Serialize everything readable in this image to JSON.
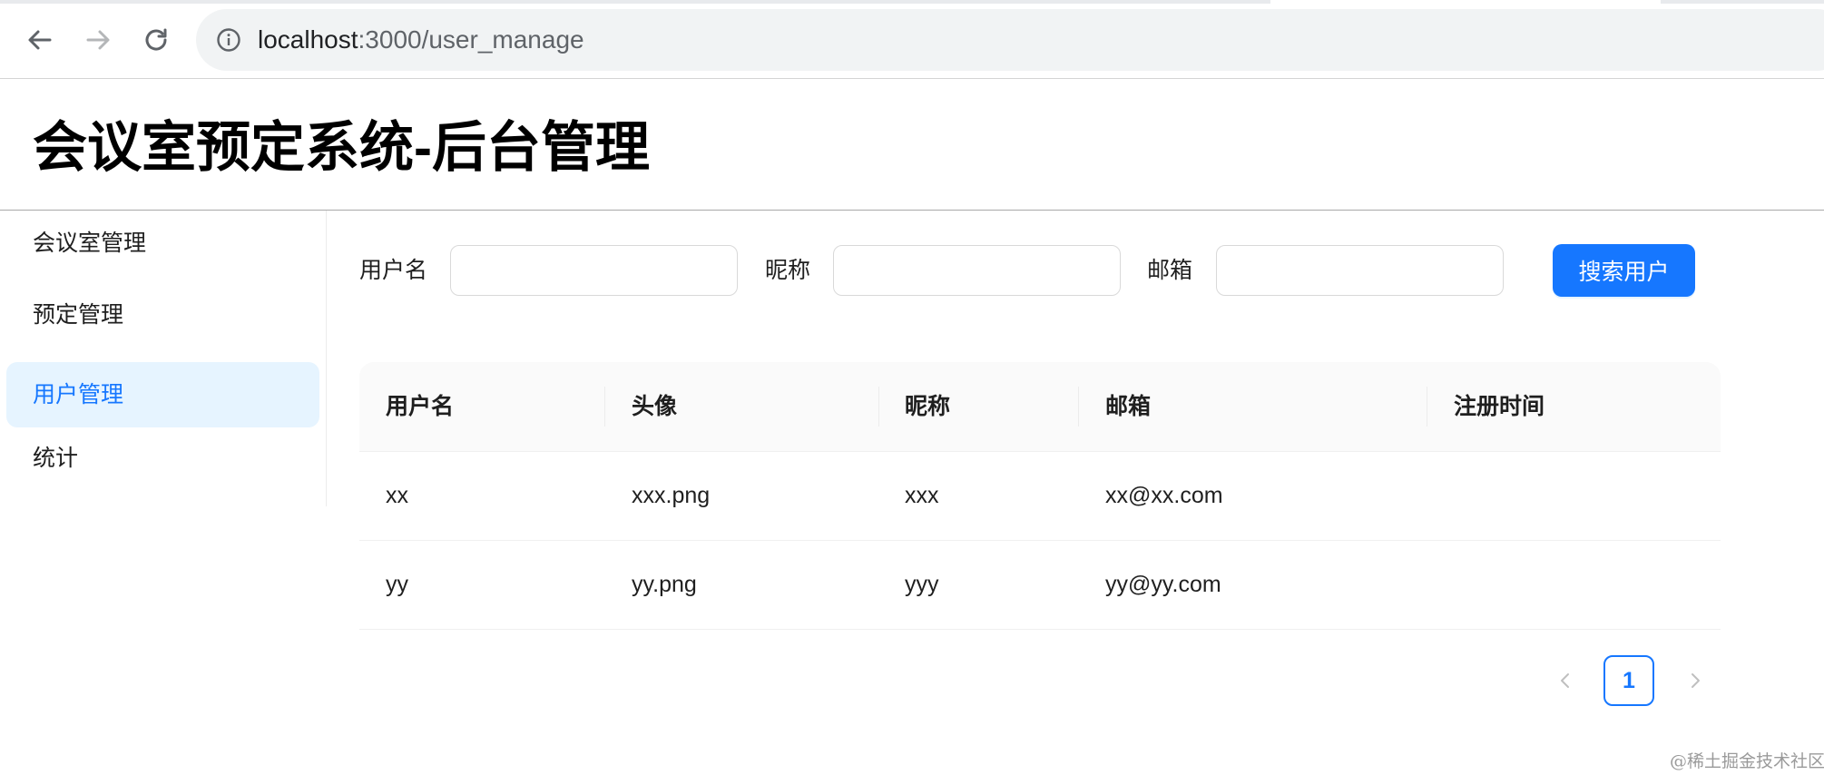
{
  "browser": {
    "url_host": "localhost",
    "url_rest": ":3000/user_manage",
    "back_icon": "arrow-left-icon",
    "forward_icon": "arrow-right-icon",
    "reload_icon": "reload-icon",
    "info_icon": "info-icon"
  },
  "header": {
    "title": "会议室预定系统-后台管理"
  },
  "sidebar": {
    "items": [
      {
        "label": "会议室管理",
        "active": false
      },
      {
        "label": "预定管理",
        "active": false
      },
      {
        "label": "用户管理",
        "active": true
      },
      {
        "label": "统计",
        "active": false
      }
    ]
  },
  "search_form": {
    "username_label": "用户名",
    "username_value": "",
    "nickname_label": "昵称",
    "nickname_value": "",
    "email_label": "邮箱",
    "email_value": "",
    "submit_label": "搜索用户"
  },
  "table": {
    "columns": [
      "用户名",
      "头像",
      "昵称",
      "邮箱",
      "注册时间"
    ],
    "rows": [
      [
        "xx",
        "xxx.png",
        "xxx",
        "xx@xx.com",
        ""
      ],
      [
        "yy",
        "yy.png",
        "yyy",
        "yy@yy.com",
        ""
      ]
    ]
  },
  "pagination": {
    "current_page": "1",
    "prev_icon": "chevron-left-icon",
    "next_icon": "chevron-right-icon"
  },
  "watermark": "@稀土掘金技术社区",
  "colors": {
    "primary": "#1677ff",
    "active_menu_bg": "#e6f4ff",
    "table_header_bg": "#fafafa"
  }
}
